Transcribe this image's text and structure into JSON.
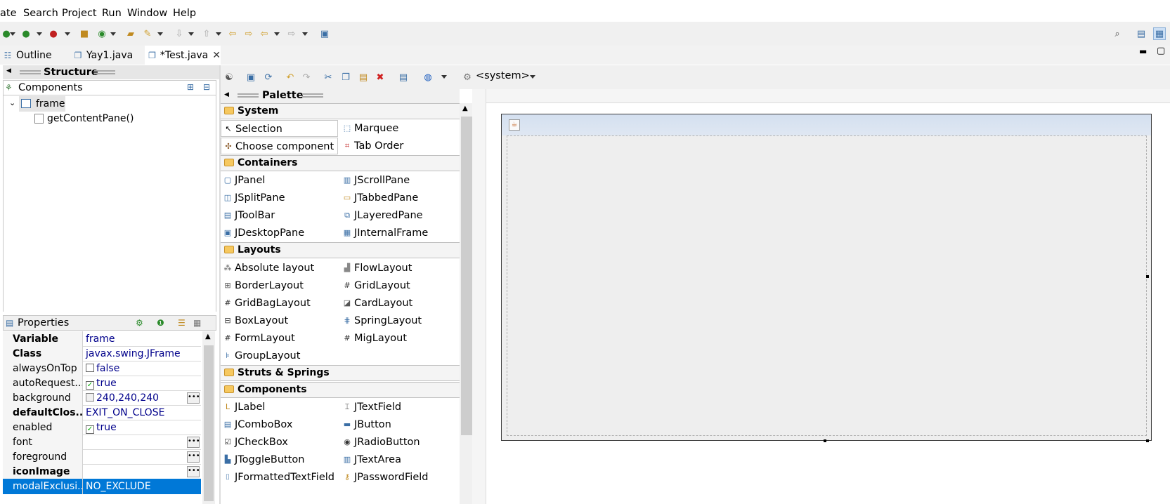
{
  "menubar": {
    "items": [
      "ate",
      "Search",
      "Project",
      "Run",
      "Window",
      "Help"
    ]
  },
  "editor_tabs": [
    {
      "label": "Outline"
    },
    {
      "label": "Yay1.java"
    },
    {
      "label": "*Test.java",
      "active": true
    }
  ],
  "structure": {
    "title": "Structure",
    "components_label": "Components",
    "tree": [
      "frame",
      "getContentPane()"
    ]
  },
  "properties": {
    "title": "Properties",
    "rows": [
      {
        "name": "Variable",
        "value": "frame",
        "bold": true
      },
      {
        "name": "Class",
        "value": "javax.swing.JFrame",
        "bold": true
      },
      {
        "name": "alwaysOnTop",
        "value": "false",
        "checkbox": false
      },
      {
        "name": "autoRequest...",
        "value": "true",
        "checkbox": true
      },
      {
        "name": "background",
        "value": "240,240,240",
        "swatch": true,
        "ellipsis": true
      },
      {
        "name": "defaultClos...",
        "value": "EXIT_ON_CLOSE",
        "bold": true
      },
      {
        "name": "enabled",
        "value": "true",
        "checkbox": true
      },
      {
        "name": "font",
        "value": "",
        "ellipsis": true
      },
      {
        "name": "foreground",
        "value": "",
        "ellipsis": true
      },
      {
        "name": "iconImage",
        "value": "",
        "bold": true,
        "ellipsis": true
      },
      {
        "name": "modalExclusi...",
        "value": "NO_EXCLUDE",
        "selected": true
      }
    ]
  },
  "designer_toolbar": {
    "system_label": "<system>"
  },
  "palette": {
    "title": "Palette",
    "categories": [
      {
        "name": "System",
        "items": [
          [
            "Selection",
            "Marquee"
          ],
          [
            "Choose component",
            "Tab Order"
          ]
        ]
      },
      {
        "name": "Containers",
        "items": [
          [
            "JPanel",
            "JScrollPane"
          ],
          [
            "JSplitPane",
            "JTabbedPane"
          ],
          [
            "JToolBar",
            "JLayeredPane"
          ],
          [
            "JDesktopPane",
            "JInternalFrame"
          ]
        ]
      },
      {
        "name": "Layouts",
        "items": [
          [
            "Absolute layout",
            "FlowLayout"
          ],
          [
            "BorderLayout",
            "GridLayout"
          ],
          [
            "GridBagLayout",
            "CardLayout"
          ],
          [
            "BoxLayout",
            "SpringLayout"
          ],
          [
            "FormLayout",
            "MigLayout"
          ],
          [
            "GroupLayout",
            ""
          ]
        ]
      },
      {
        "name": "Struts & Springs",
        "items": []
      },
      {
        "name": "Components",
        "items": [
          [
            "JLabel",
            "JTextField"
          ],
          [
            "JComboBox",
            "JButton"
          ],
          [
            "JCheckBox",
            "JRadioButton"
          ],
          [
            "JToggleButton",
            "JTextArea"
          ],
          [
            "JFormattedTextField",
            "JPasswordField"
          ]
        ]
      }
    ]
  },
  "colors": {
    "selection": "#0078d7",
    "property_value": "#00008b",
    "frame_title": "#d4e0f0"
  }
}
